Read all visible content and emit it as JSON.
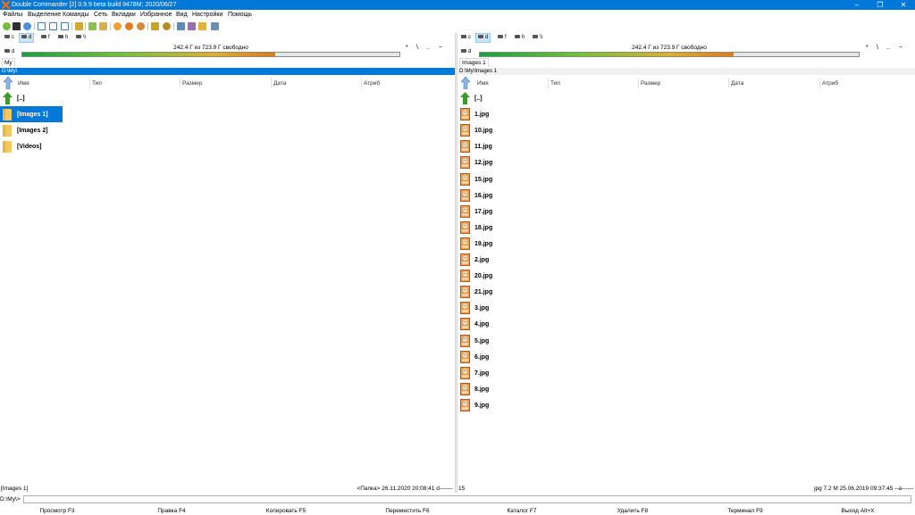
{
  "window": {
    "title": "Double Commander [2] 0.9.9 beta build 9478M; 2020/06/27"
  },
  "menu": [
    "Файлы",
    "Выделение",
    "Команды",
    "Сеть",
    "Вкладки",
    "Избранное",
    "Вид",
    "Настройки",
    "Помощь"
  ],
  "left": {
    "drives": [
      "c",
      "d",
      "f",
      "h",
      "\\\\"
    ],
    "active_drive": "d",
    "space_text": "242.4 Г из 723.9 Г свободно",
    "space_fill_fraction": 0.67,
    "path_buttons": [
      "*",
      "\\",
      "..",
      "~"
    ],
    "tab": "My",
    "path": "D:\\My\\",
    "columns": [
      "Имя",
      "Тип",
      "Размер",
      "Дата",
      "Атриб"
    ],
    "items": [
      {
        "name": "[..]",
        "icon": "up-folder-icon"
      },
      {
        "name": "[Images 1]",
        "icon": "folder-icon",
        "selected": true
      },
      {
        "name": "[Images 2]",
        "icon": "folder-icon"
      },
      {
        "name": "[Videos]",
        "icon": "folder-icon"
      }
    ],
    "status": {
      "name": "[Images 1]",
      "info": "<Папка>  26.11.2020 20:08:41  d-------"
    }
  },
  "right": {
    "drives": [
      "c",
      "d",
      "f",
      "h",
      "\\\\"
    ],
    "active_drive": "d",
    "space_text": "242.4 Г из 723.9 Г свободно",
    "space_fill_fraction": 0.67,
    "path_buttons": [
      "*",
      "\\",
      "..",
      "~"
    ],
    "tab": "Images 1",
    "path": "D:\\My\\Images 1",
    "columns": [
      "Имя",
      "Тип",
      "Размер",
      "Дата",
      "Атриб"
    ],
    "items": [
      {
        "name": "[..]",
        "icon": "up-folder-icon"
      },
      {
        "name": "1.jpg",
        "icon": "image-file-icon"
      },
      {
        "name": "10.jpg",
        "icon": "image-file-icon"
      },
      {
        "name": "11.jpg",
        "icon": "image-file-icon"
      },
      {
        "name": "12.jpg",
        "icon": "image-file-icon"
      },
      {
        "name": "15.jpg",
        "icon": "image-file-icon"
      },
      {
        "name": "16.jpg",
        "icon": "image-file-icon"
      },
      {
        "name": "17.jpg",
        "icon": "image-file-icon"
      },
      {
        "name": "18.jpg",
        "icon": "image-file-icon"
      },
      {
        "name": "19.jpg",
        "icon": "image-file-icon"
      },
      {
        "name": "2.jpg",
        "icon": "image-file-icon"
      },
      {
        "name": "20.jpg",
        "icon": "image-file-icon"
      },
      {
        "name": "21.jpg",
        "icon": "image-file-icon"
      },
      {
        "name": "3.jpg",
        "icon": "image-file-icon"
      },
      {
        "name": "4.jpg",
        "icon": "image-file-icon"
      },
      {
        "name": "5.jpg",
        "icon": "image-file-icon"
      },
      {
        "name": "6.jpg",
        "icon": "image-file-icon"
      },
      {
        "name": "7.jpg",
        "icon": "image-file-icon"
      },
      {
        "name": "8.jpg",
        "icon": "image-file-icon"
      },
      {
        "name": "9.jpg",
        "icon": "image-file-icon"
      }
    ],
    "status": {
      "name": "15",
      "info": "jpg  7.2 M  25.06.2019 09:37:45  --a------"
    }
  },
  "cmdline": {
    "label": "D:\\My\\>",
    "value": ""
  },
  "fkeys": [
    "Просмотр F3",
    "Правка F4",
    "Копировать F5",
    "Переместить F6",
    "Каталог F7",
    "Удалить F8",
    "Терминал F9",
    "Выход Alt+X"
  ],
  "colors": {
    "accent": "#0078d7",
    "selection": "#0078d7",
    "folder": "#f7c75c",
    "up_arrow": "#3c9a2a"
  }
}
